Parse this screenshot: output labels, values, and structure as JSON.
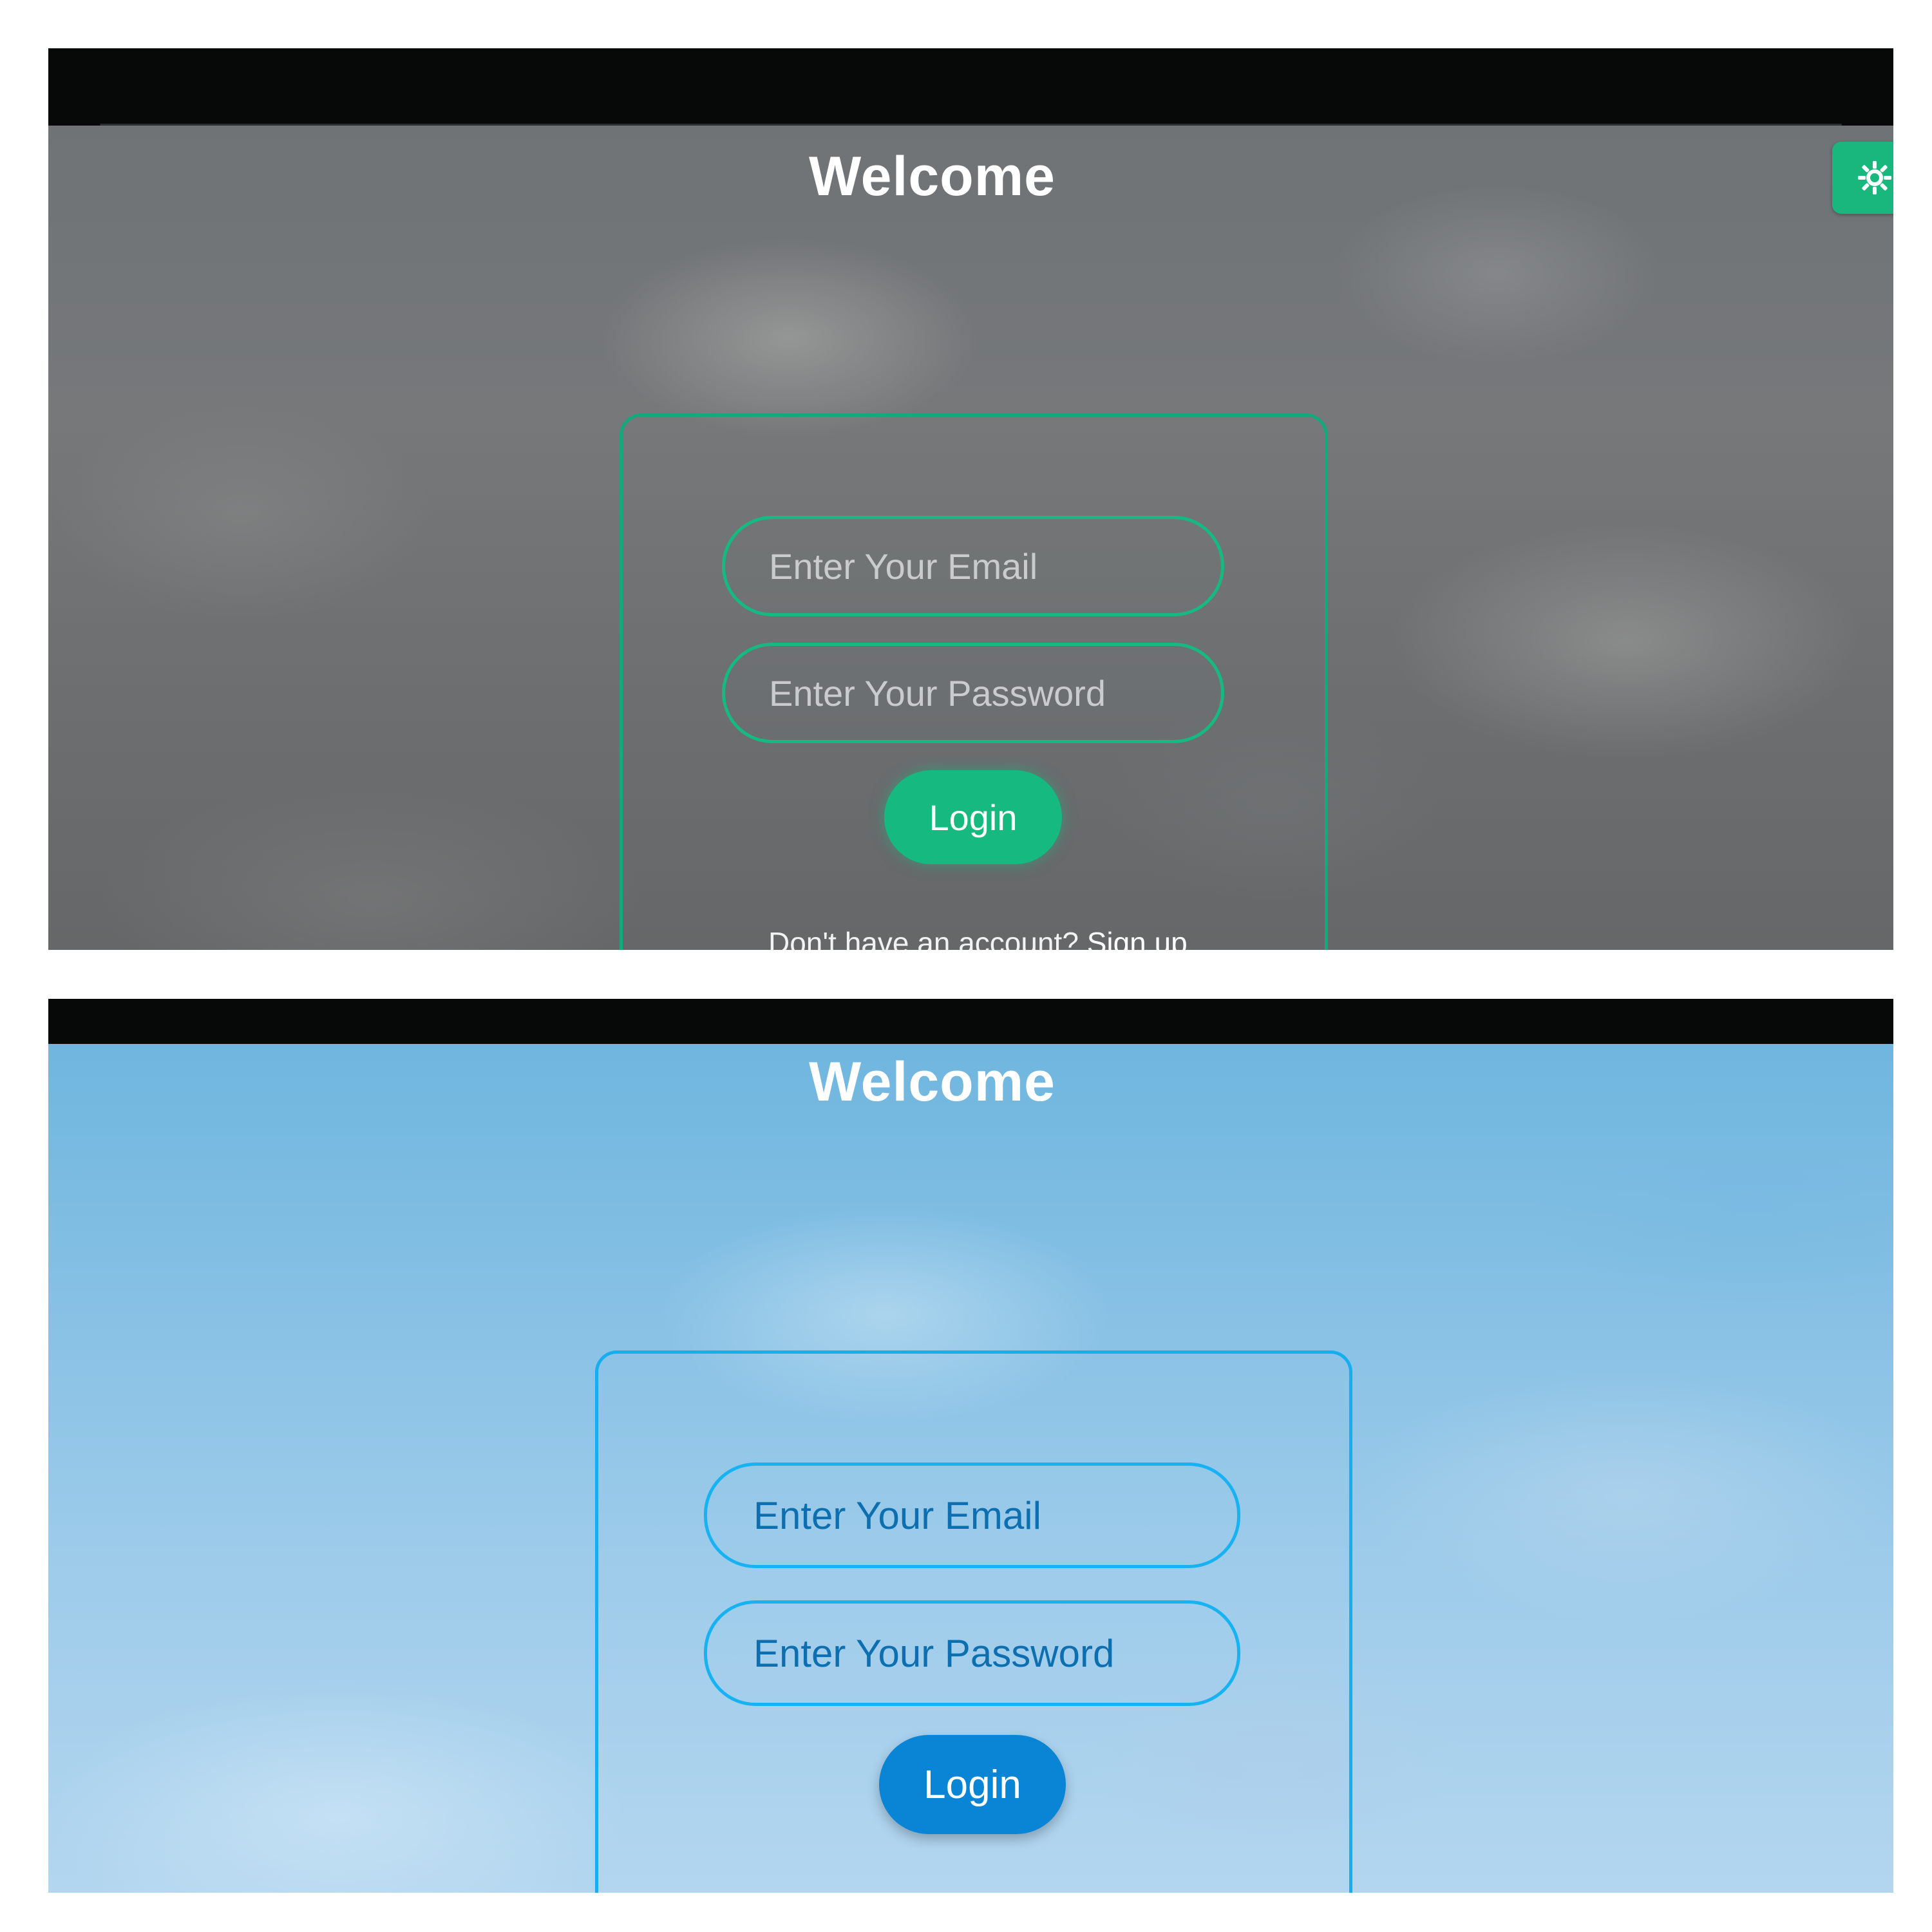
{
  "screens": {
    "dark": {
      "welcome": "Welcome",
      "email_placeholder": "Enter Your Email",
      "password_placeholder": "Enter Your Password",
      "login_label": "Login",
      "signup_prompt": "Don't have an account?",
      "signup_link": "Sign up",
      "accent_color": "#16ba80"
    },
    "light": {
      "welcome": "Welcome",
      "email_placeholder": "Enter Your Email",
      "password_placeholder": "Enter Your Password",
      "login_label": "Login",
      "accent_color": "#0a84d5"
    }
  },
  "theme_toggle": {
    "icon": "sun-gear-icon"
  }
}
